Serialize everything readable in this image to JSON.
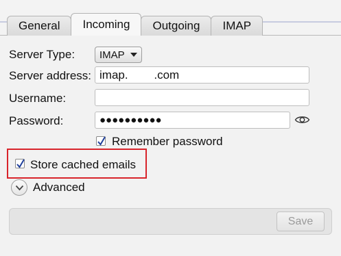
{
  "tabs": [
    {
      "label": "General"
    },
    {
      "label": "Incoming"
    },
    {
      "label": "Outgoing"
    },
    {
      "label": "IMAP"
    }
  ],
  "form": {
    "server_type_label": "Server Type:",
    "server_type_value": "IMAP",
    "server_address_label": "Server address:",
    "server_address_value": "imap.        .com",
    "username_label": "Username:",
    "username_value": "",
    "password_label": "Password:",
    "password_value": "●●●●●●●●●●",
    "remember_password_label": "Remember password",
    "remember_password_checked": true,
    "store_cached_label": "Store cached emails",
    "store_cached_checked": true,
    "advanced_label": "Advanced"
  },
  "footer": {
    "save_label": "Save"
  },
  "icons": {
    "password_reveal": "eye-icon",
    "expander": "chevron-down-icon",
    "check": "checkmark-icon"
  },
  "colors": {
    "highlight_border": "#d8232a",
    "checkmark": "#1f3f9b",
    "save_disabled_text": "#9a9a9a"
  }
}
